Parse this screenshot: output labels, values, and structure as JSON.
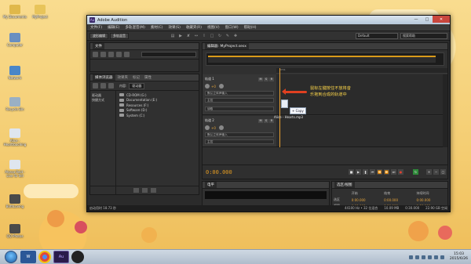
{
  "desktop": {
    "icons": [
      {
        "label": "My Documents",
        "icon": "folder-icon",
        "color": "#e0b84a"
      },
      {
        "label": "MyProject",
        "icon": "folder-icon",
        "color": "#e8c45a"
      },
      {
        "label": "Computer",
        "icon": "computer-icon",
        "color": "#6a8fc0"
      },
      {
        "label": "Network",
        "icon": "network-icon",
        "color": "#4a86c8"
      },
      {
        "label": "Recycle Bin",
        "icon": "recycle-bin-icon",
        "color": "#9ab0c4"
      },
      {
        "label": "Alice - Hearttouching",
        "icon": "audio-file-icon",
        "color": "#dfe6ef"
      },
      {
        "label": "Alyssa Reid - Live To Tell",
        "icon": "audio-file-icon",
        "color": "#dfe6ef"
      },
      {
        "label": "BothLoving",
        "icon": "app-icon",
        "color": "#4a4a4a"
      },
      {
        "label": "QQ Photos",
        "icon": "app-icon",
        "color": "#4a4a4a"
      }
    ]
  },
  "window": {
    "title": "Adobe Audition",
    "menu": [
      "文件(F)",
      "编辑(E)",
      "多轨混音(M)",
      "素材(C)",
      "效果(S)",
      "收藏夹(R)",
      "视图(V)",
      "窗口(W)",
      "帮助(H)"
    ],
    "toolbar": {
      "btn_waveform": "波形编辑",
      "btn_multitrack": "多轨混音",
      "workspace": "Default",
      "search_placeholder": "搜索帮助"
    },
    "files_panel": {
      "title": "文件"
    },
    "media_panel": {
      "tabs": [
        "媒体浏览器",
        "效果夹",
        "标记",
        "属性"
      ],
      "tree": [
        "驱动器",
        "快捷方式"
      ],
      "content_label": "内容:",
      "content_value": "驱动器",
      "drives": [
        {
          "letter": "G:",
          "label": "CD-ROM (G:)"
        },
        {
          "letter": "E:",
          "label": "Documentation (E:)"
        },
        {
          "letter": "F:",
          "label": "Resources (F:)"
        },
        {
          "letter": "D:",
          "label": "Software (D:)"
        },
        {
          "letter": "C:",
          "label": "System (C:)"
        }
      ]
    },
    "editor": {
      "tab": "编辑器: MyProject.sesx",
      "ruler_unit": "hms",
      "tracks": [
        {
          "name": "轨道 1",
          "volume": "+0",
          "input": "默认立体声输入",
          "output": "主控",
          "read": "读取"
        },
        {
          "name": "轨道 2",
          "volume": "+0",
          "input": "默认立体声输入",
          "output": "主控"
        }
      ],
      "time": "0:00.000"
    },
    "annotation": {
      "line1": "鼠标左键按住不放将音",
      "line2": "乐拖到合成的轨道中"
    },
    "drag": {
      "file_label": "Alice - Hearts.mp3",
      "copy_label": "+ Copy"
    },
    "levels": {
      "title": "电平"
    },
    "selection": {
      "title": "选区/视图",
      "headers": [
        "",
        "开始",
        "结束",
        "持续时间"
      ],
      "rows": [
        {
          "label": "选区",
          "start": "0:00.000",
          "end": "0:00.000",
          "dur": "0:00.000"
        },
        {
          "label": "视图",
          "start": "0:00.000",
          "end": "0:30.000",
          "dur": "0:30.000"
        }
      ]
    },
    "status": {
      "left": "启动用时 18.73 秒",
      "sample": "44100 Hz • 32 位混合",
      "size": "10.09 MB",
      "duration": "0:30.000",
      "free": "22.90 GB 空闲"
    }
  },
  "taskbar": {
    "time": "15:03",
    "date": "2015/6/26"
  }
}
